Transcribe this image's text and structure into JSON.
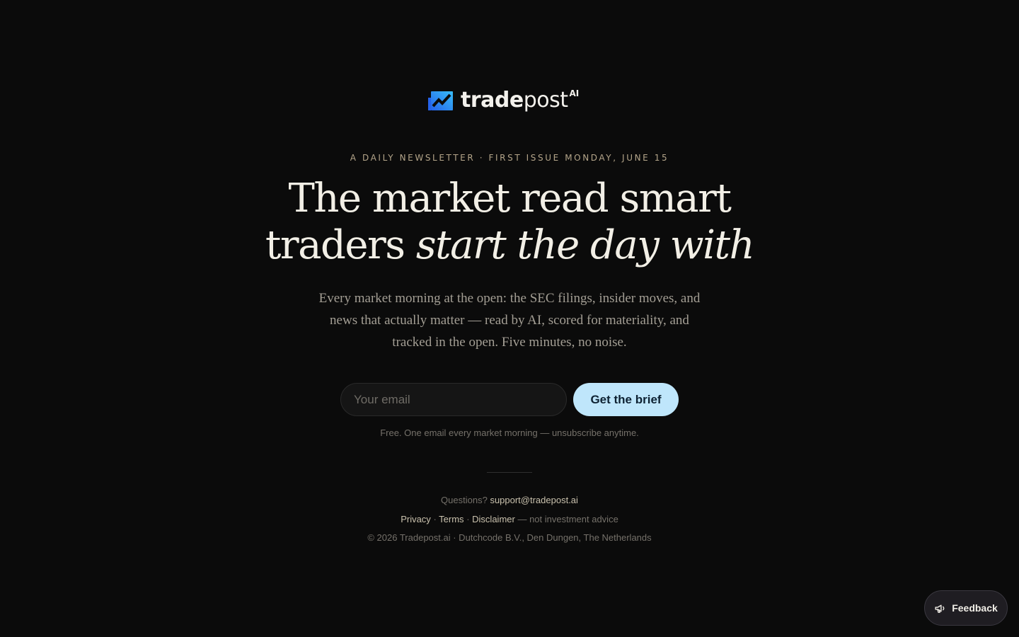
{
  "brand": {
    "name_bold": "trade",
    "name_light": "post",
    "superscript": "AI",
    "accent_color": "#2aa8f2"
  },
  "hero": {
    "eyebrow": "A DAILY NEWSLETTER · FIRST ISSUE MONDAY, JUNE 15",
    "headline_line1": "The market read smart",
    "headline_line2_plain": "traders ",
    "headline_line2_italic": "start the day with",
    "subtext": "Every market morning at the open: the SEC filings, insider moves, and news that actually matter — read by AI, scored for materiality, and tracked in the open. Five minutes, no noise."
  },
  "signup": {
    "email_placeholder": "Your email",
    "email_value": "",
    "button_label": "Get the brief",
    "button_color": "#bfe6fb",
    "fineprint": "Free. One email every market morning — unsubscribe anytime."
  },
  "footer": {
    "questions_label": "Questions?",
    "support_email": "support@tradepost.ai",
    "privacy_label": "Privacy",
    "terms_label": "Terms",
    "disclaimer_label": "Disclaimer",
    "disclaimer_note": "— not investment advice",
    "separator": "·",
    "copyright": "© 2026 Tradepost.ai · Dutchcode B.V., Den Dungen, The Netherlands"
  },
  "feedback": {
    "label": "Feedback",
    "icon": "megaphone-icon"
  }
}
